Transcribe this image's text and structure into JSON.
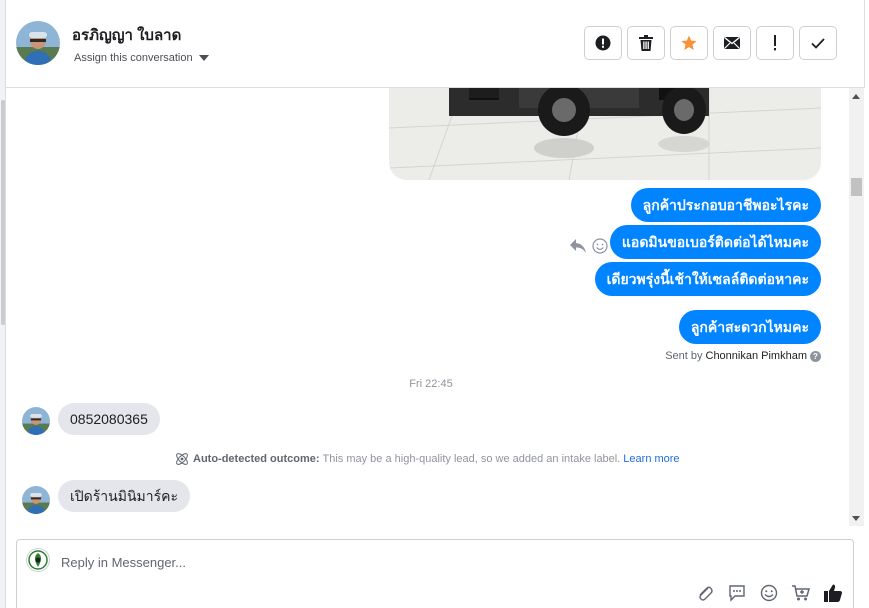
{
  "header": {
    "contact_name": "อรภิญญา ใบลาด",
    "assign_label": "Assign this conversation",
    "actions": [
      {
        "icon": "alert-circle-icon",
        "name": "spam-button"
      },
      {
        "icon": "trash-icon",
        "name": "delete-button"
      },
      {
        "icon": "star-icon",
        "name": "star-button"
      },
      {
        "icon": "envelope-icon",
        "name": "mark-unread-button"
      },
      {
        "icon": "exclamation-icon",
        "name": "follow-up-button"
      },
      {
        "icon": "check-icon",
        "name": "done-button"
      }
    ]
  },
  "messages": {
    "outgoing": [
      "ลูกค้าประกอบอาชีพอะไรคะ",
      "แอดมินขอเบอร์ติดต่อได้ไหมคะ",
      "เดียวพรุ่งนี้เช้าให้เซลล์ติดต่อหาคะ",
      "ลูกค้าสะดวกไหมคะ"
    ],
    "sent_by_prefix": "Sent by",
    "sent_by_name": "Chonnikan Pimkham",
    "timestamp": "Fri 22:45",
    "incoming_1": "0852080365",
    "auto_outcome": {
      "label": "Auto-detected outcome:",
      "text": "This may be a high-quality lead, so we added an intake label.",
      "link": "Learn more"
    },
    "incoming_2": "เปิดร้านมินิมาร์คะ"
  },
  "composer": {
    "placeholder": "Reply in Messenger...",
    "tools": [
      "paperclip-icon",
      "saved-reply-icon",
      "emoji-icon",
      "cart-icon",
      "thumbs-up-icon"
    ]
  },
  "colors": {
    "accent": "#0084ff",
    "incoming_bubble": "#e4e6eb",
    "star": "#f7923a",
    "link": "#216fdb"
  }
}
